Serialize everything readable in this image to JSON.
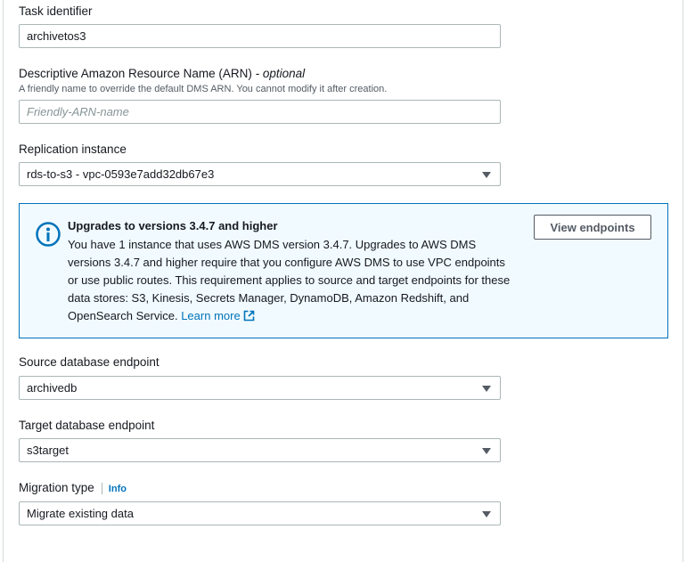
{
  "task_identifier": {
    "label": "Task identifier",
    "value": "archivetos3"
  },
  "arn": {
    "label": "Descriptive Amazon Resource Name (ARN)",
    "optional_label": "- optional",
    "hint": "A friendly name to override the default DMS ARN. You cannot modify it after creation.",
    "placeholder": "Friendly-ARN-name"
  },
  "replication_instance": {
    "label": "Replication instance",
    "value": "rds-to-s3 - vpc-0593e7add32db67e3"
  },
  "alert": {
    "title": "Upgrades to versions 3.4.7 and higher",
    "body": "You have 1 instance that uses AWS DMS version 3.4.7. Upgrades to AWS DMS versions 3.4.7 and higher require that you configure AWS DMS to use VPC endpoints or use public routes. This requirement applies to source and target endpoints for these data stores: S3, Kinesis, Secrets Manager, DynamoDB, Amazon Redshift, and OpenSearch Service.",
    "learn_more": "Learn more",
    "button_label": "View endpoints",
    "icon": "info-icon",
    "accent_color": "#0073bb"
  },
  "source_endpoint": {
    "label": "Source database endpoint",
    "value": "archivedb"
  },
  "target_endpoint": {
    "label": "Target database endpoint",
    "value": "s3target"
  },
  "migration_type": {
    "label": "Migration type",
    "info_link": "Info",
    "value": "Migrate existing data"
  }
}
